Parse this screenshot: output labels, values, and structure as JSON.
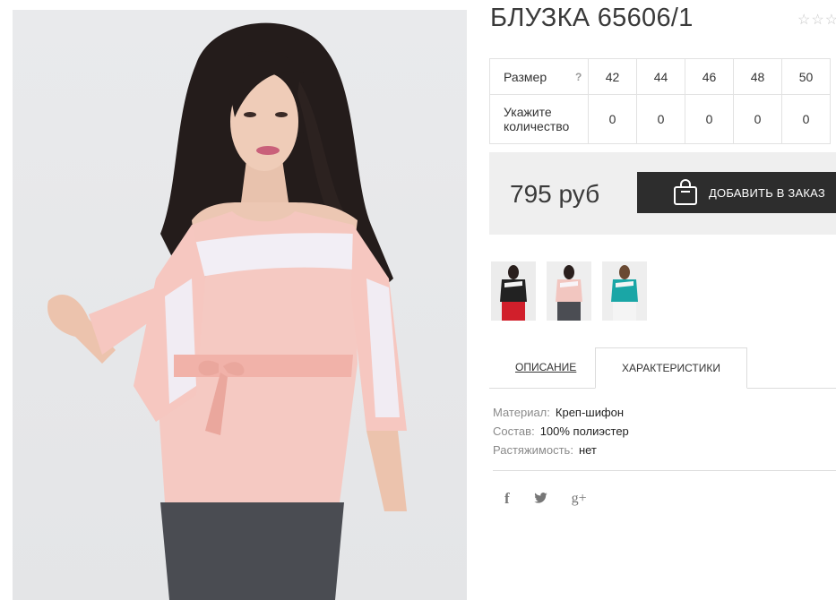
{
  "product": {
    "title": "БЛУЗКА 65606/1",
    "rating_stars": "☆☆☆",
    "price": "795 руб",
    "add_to_cart_label": "ДОБАВИТЬ В ЗАКАЗ"
  },
  "size_table": {
    "size_label": "Размер",
    "help": "?",
    "quantity_label": "Укажите количество",
    "sizes": [
      "42",
      "44",
      "46",
      "48",
      "50"
    ],
    "quantities": [
      "0",
      "0",
      "0",
      "0",
      "0"
    ]
  },
  "thumbnails": [
    {
      "color": "black",
      "accent": "#222222"
    },
    {
      "color": "pink",
      "accent": "#f2c6c0"
    },
    {
      "color": "turquoise",
      "accent": "#1aa6a6"
    }
  ],
  "tabs": {
    "description": "ОПИСАНИЕ",
    "characteristics": "ХАРАКТЕРИСТИКИ",
    "active": "characteristics"
  },
  "specs": [
    {
      "key": "Материал:",
      "value": "Креп-шифон"
    },
    {
      "key": "Состав:",
      "value": "100% полиэстер"
    },
    {
      "key": "Растяжимость:",
      "value": "нет"
    }
  ],
  "social": {
    "facebook": "f",
    "twitter": "🐦",
    "googleplus": "g+"
  },
  "icons": [
    "shopping-bag-icon",
    "star-icon",
    "facebook-icon",
    "twitter-icon",
    "google-plus-icon"
  ]
}
